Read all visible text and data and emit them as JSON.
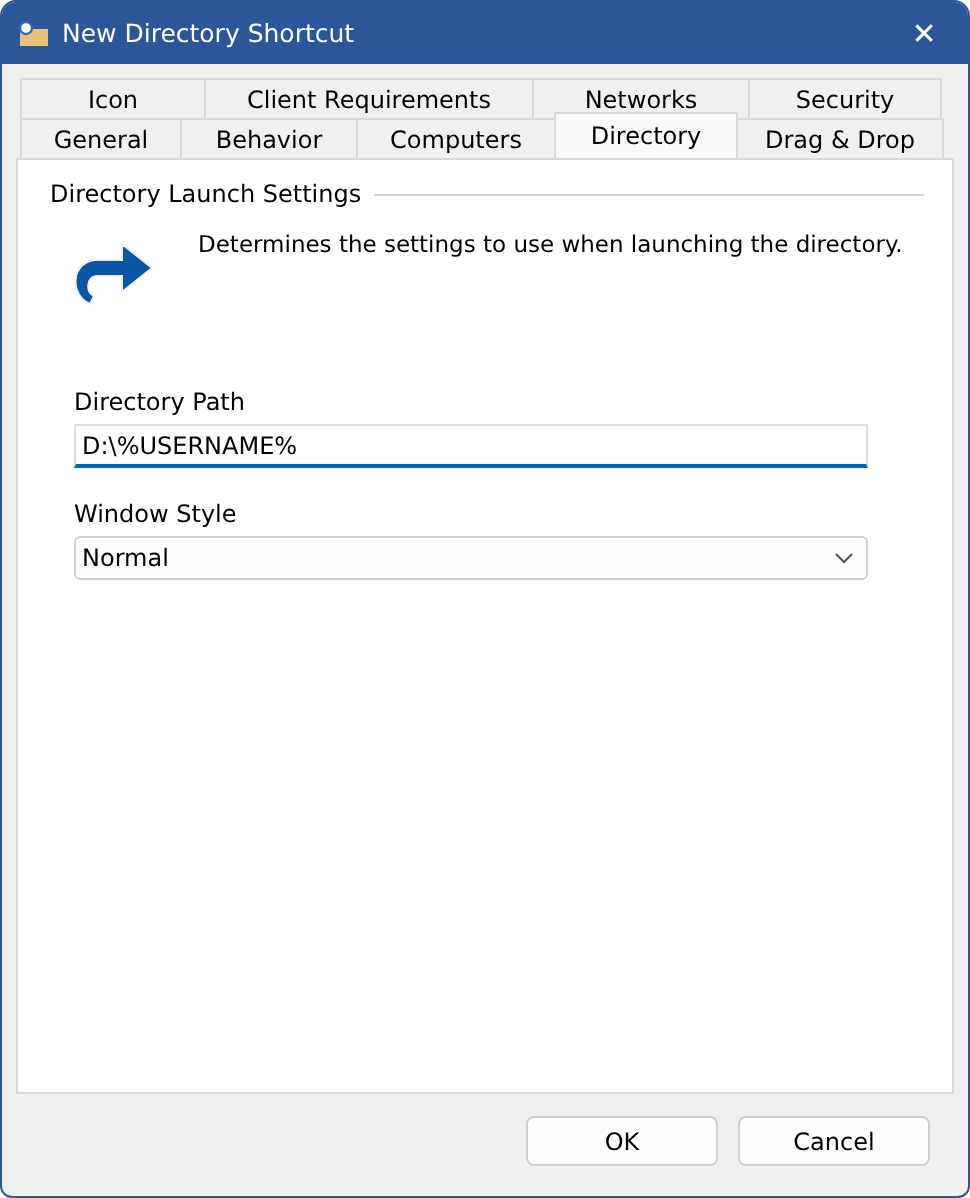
{
  "window": {
    "title": "New Directory Shortcut",
    "close": "✕"
  },
  "tab_rows": [
    [
      {
        "label": "Icon",
        "selected": false
      },
      {
        "label": "Client Requirements",
        "selected": false
      },
      {
        "label": "Networks",
        "selected": false
      },
      {
        "label": "Security",
        "selected": false
      }
    ],
    [
      {
        "label": "General",
        "selected": false
      },
      {
        "label": "Behavior",
        "selected": false
      },
      {
        "label": "Computers",
        "selected": false
      },
      {
        "label": "Directory",
        "selected": true
      },
      {
        "label": "Drag & Drop",
        "selected": false
      }
    ]
  ],
  "group": {
    "title": "Directory Launch Settings",
    "description": "Determines the settings to use when launching the directory."
  },
  "fields": [
    {
      "kind": "text",
      "label": "Directory Path",
      "value": "D:\\%USERNAME%",
      "focused": true
    },
    {
      "kind": "dropdown",
      "label": "Window Style",
      "value": "Normal",
      "focused": false
    }
  ],
  "buttons": [
    "OK",
    "Cancel"
  ]
}
